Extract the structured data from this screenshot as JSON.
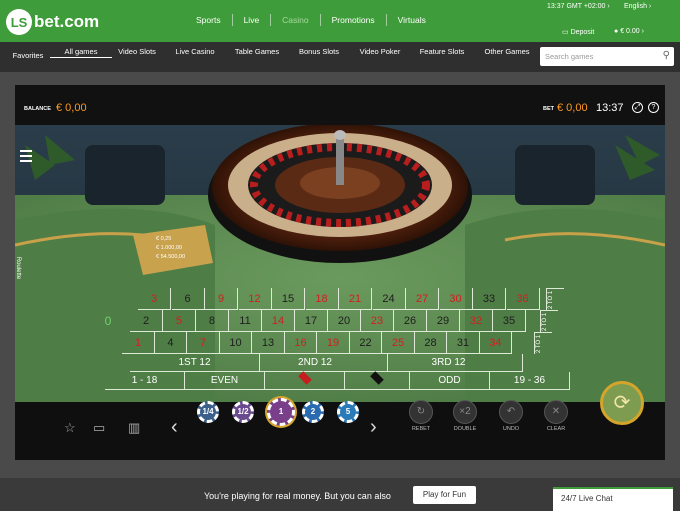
{
  "header": {
    "logo_mark": "LS",
    "logo_text": "bet.com",
    "nav": [
      "Sports",
      "Live",
      "Casino",
      "Promotions",
      "Virtuals"
    ],
    "clock": "13:37 GMT +02:00 ›",
    "language": "English ›",
    "deposit": "Deposit",
    "balance": "€ 0.00 ›"
  },
  "subnav": {
    "items": [
      "Favorites",
      "All games",
      "Video Slots",
      "Live Casino",
      "Table Games",
      "Bonus Slots",
      "Video Poker",
      "Feature Slots",
      "Other Games"
    ],
    "search_placeholder": "Search games"
  },
  "game": {
    "balance_label": "BALANCE",
    "balance_value": "€ 0,00",
    "bet_label": "BET",
    "bet_value": "€ 0,00",
    "time": "13:37",
    "side_label": "Roulette",
    "limits": [
      "€ 0,25",
      "€ 1.000,00",
      "€ 54.500,00"
    ],
    "zero": "0",
    "row_top": [
      "3",
      "6",
      "9",
      "12",
      "15",
      "18",
      "21",
      "24",
      "27",
      "30",
      "33",
      "36"
    ],
    "row_mid": [
      "2",
      "5",
      "8",
      "11",
      "14",
      "17",
      "20",
      "23",
      "26",
      "29",
      "32",
      "35"
    ],
    "row_bot": [
      "1",
      "4",
      "7",
      "10",
      "13",
      "16",
      "19",
      "22",
      "25",
      "28",
      "31",
      "34"
    ],
    "red_numbers": [
      "1",
      "3",
      "5",
      "7",
      "9",
      "12",
      "14",
      "16",
      "18",
      "19",
      "21",
      "23",
      "25",
      "27",
      "30",
      "32",
      "34",
      "36"
    ],
    "col_bets": [
      "2 TO 1",
      "2 TO 1",
      "2 TO 1"
    ],
    "dozens": [
      "1ST 12",
      "2ND 12",
      "3RD 12"
    ],
    "outside": [
      "1 - 18",
      "EVEN",
      "",
      "",
      "ODD",
      "19 - 36"
    ],
    "chips": [
      "1/4",
      "1/2",
      "1",
      "2",
      "5"
    ],
    "chip_colors": [
      "#3b5f8a",
      "#6a4a8e",
      "#7a3f8a",
      "#2a6ab0",
      "#2a7ab8"
    ],
    "round_buttons": [
      "REBET",
      "DOUBLE",
      "UNDO",
      "CLEAR"
    ]
  },
  "footer": {
    "text": "You're playing for real money. But you can also",
    "button": "Play for Fun",
    "chat": "24/7 Live Chat"
  }
}
